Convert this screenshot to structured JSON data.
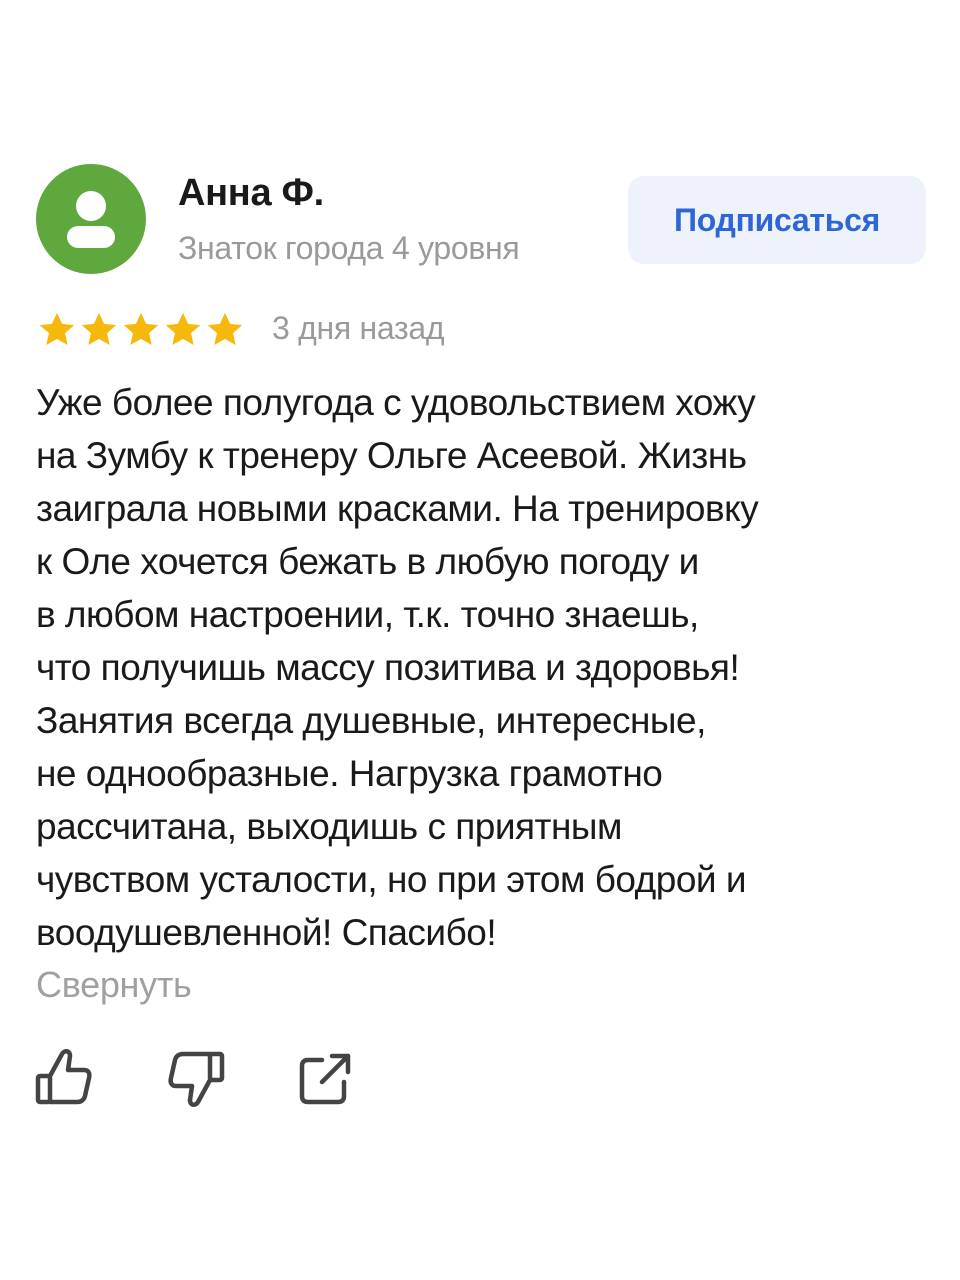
{
  "author": {
    "name": "Анна Ф.",
    "level": "Знаток города 4 уровня",
    "avatar_color": "#5fa83e",
    "avatar_icon": "user-silhouette-icon"
  },
  "subscribe": {
    "label": "Подписаться",
    "color": "#2e66d6",
    "background": "#eef3fb"
  },
  "rating": {
    "stars": 5,
    "max": 5,
    "color": "#f5b80b",
    "date": "3 дня назад"
  },
  "review": {
    "lines": [
      "Уже более полугода с удовольствием хожу",
      "на Зумбу к тренеру Ольге Асеевой. Жизнь",
      "заиграла новыми красками. На тренировку",
      "к Оле хочется бежать в любую погоду и",
      "в любом настроении, т.к. точно знаешь,",
      "что получишь массу позитива и здоровья!",
      "Занятия всегда душевные, интересные,",
      "не однообразные. Нагрузка грамотно",
      "рассчитана, выходишь с приятным",
      "чувством усталости, но при этом бодрой и",
      "воодушевленной! Спасибо!"
    ],
    "collapse_label": "Свернуть"
  },
  "actions": [
    {
      "name": "like",
      "icon": "thumbs-up-icon"
    },
    {
      "name": "dislike",
      "icon": "thumbs-down-icon"
    },
    {
      "name": "share",
      "icon": "share-icon"
    }
  ]
}
